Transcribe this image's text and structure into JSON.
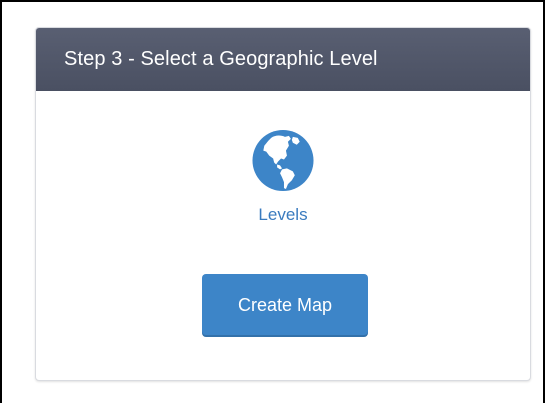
{
  "panel": {
    "title": "Step 3 - Select a Geographic Level"
  },
  "level_option": {
    "icon": "globe-americas-icon",
    "label": "Levels"
  },
  "actions": {
    "create_map_label": "Create Map"
  },
  "colors": {
    "header_bg": "#4f5567",
    "accent": "#3d85c8",
    "link": "#3a7bbf"
  }
}
